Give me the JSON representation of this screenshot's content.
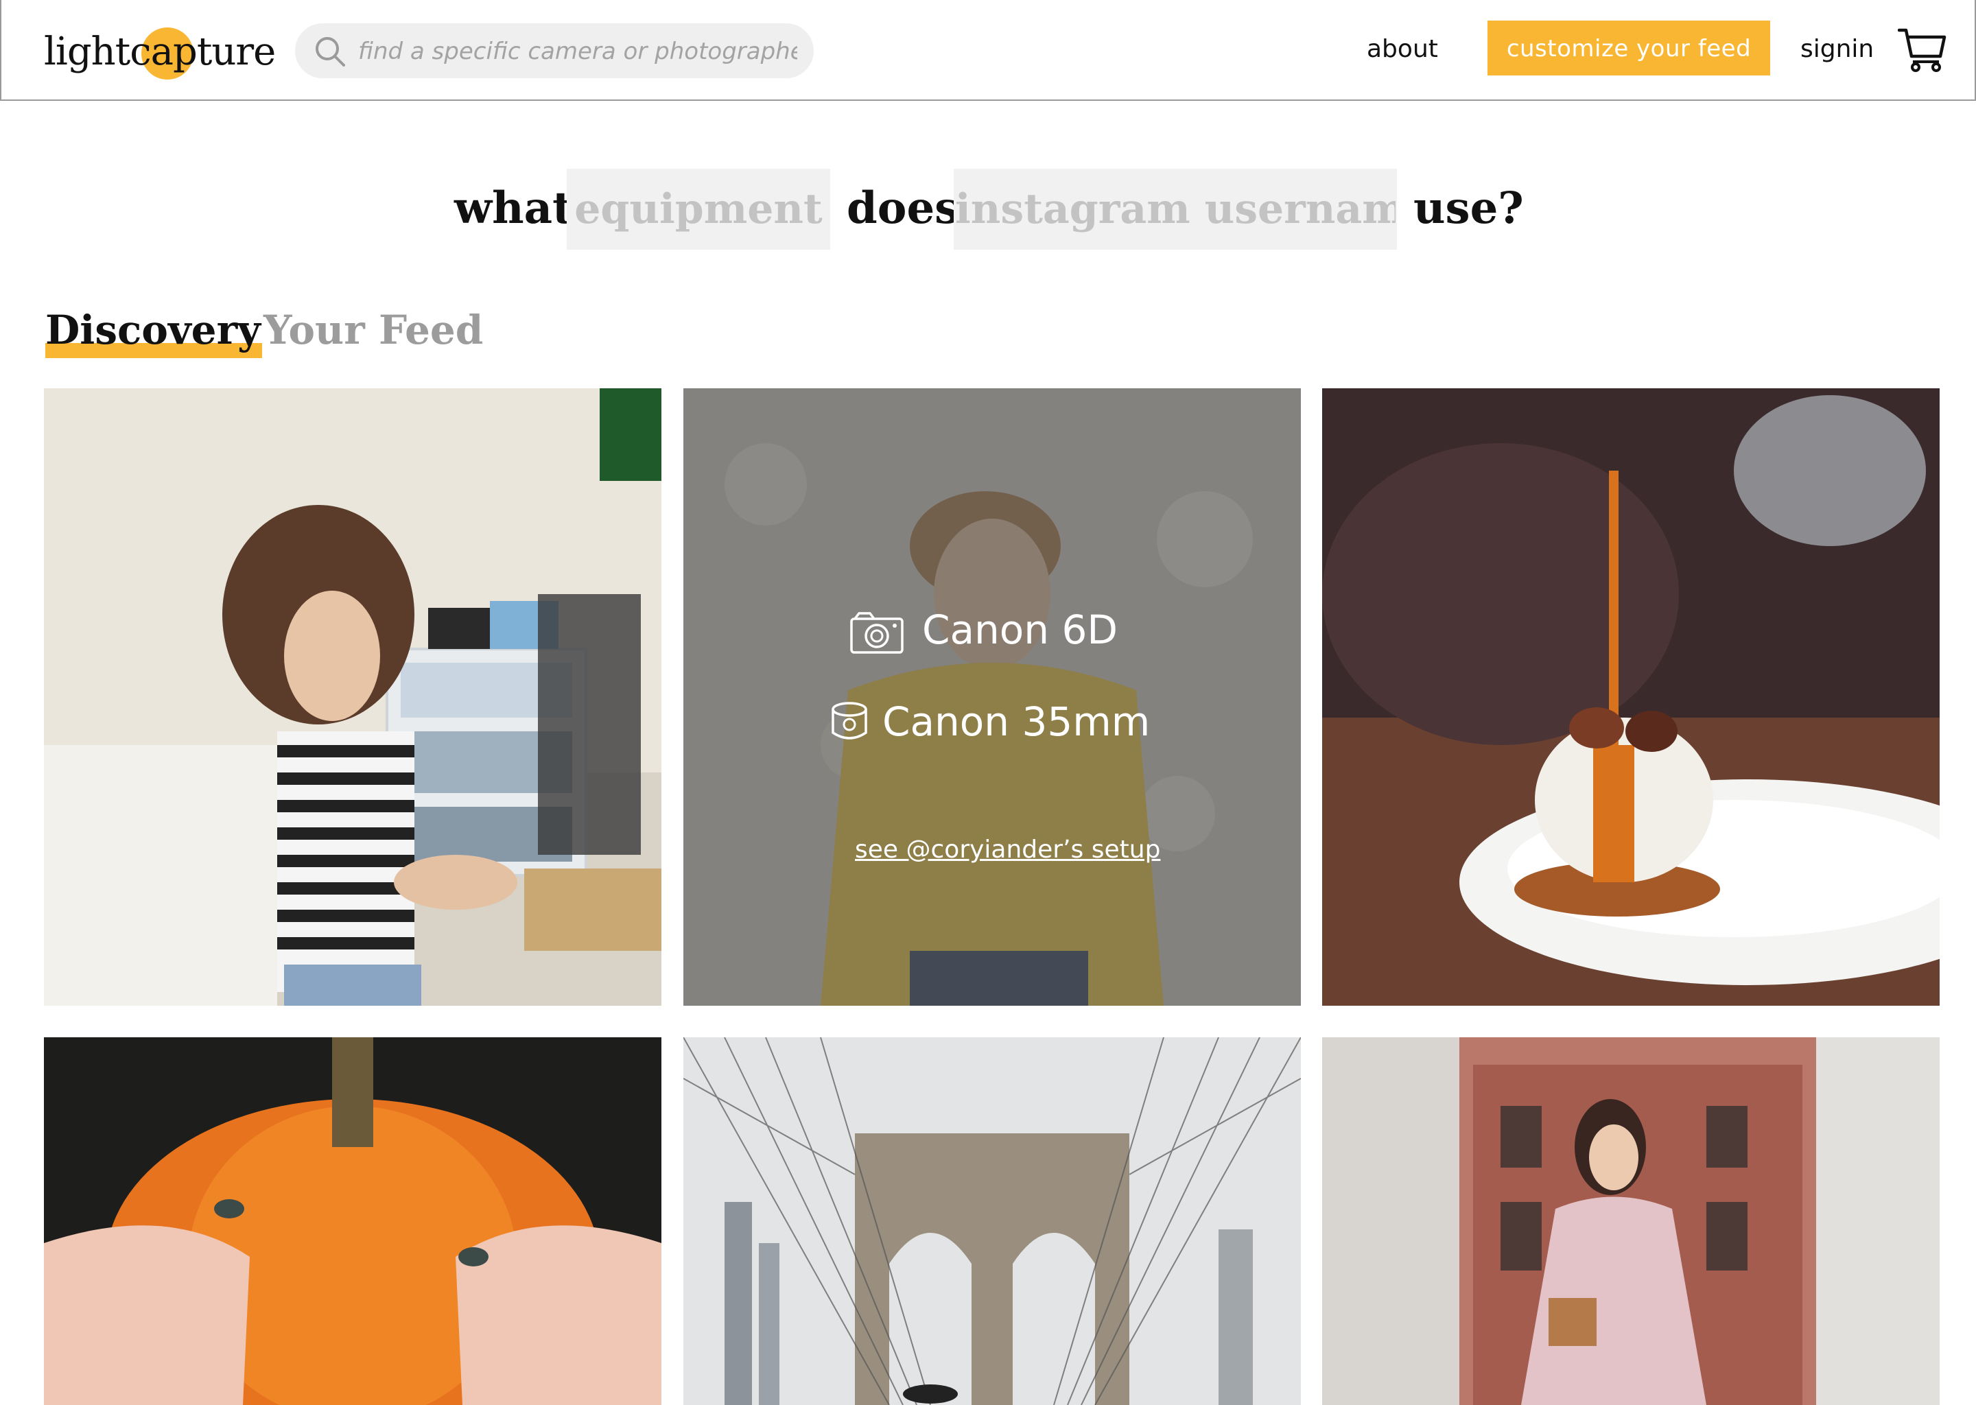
{
  "brand": {
    "logo_text": "lightcapture",
    "accent_color": "#f9b633"
  },
  "header": {
    "search_placeholder": "find a specific camera or photographer",
    "search_icon": "search-icon",
    "about_label": "about",
    "cta_label": "customize your feed",
    "signin_label": "signin",
    "cart_icon": "cart-icon"
  },
  "question": {
    "word_what": "what",
    "equipment_placeholder": "equipment",
    "word_does": "does",
    "username_placeholder": "instagram username",
    "word_use": "use?"
  },
  "tabs": {
    "discovery": "Discovery",
    "your_feed": "Your Feed"
  },
  "grid": {
    "photos": [
      {
        "subject": "woman in striped shirt sitting in a room"
      },
      {
        "subject": "man with glasses in yellow shirt",
        "overlay": {
          "camera_icon": "camera-icon",
          "camera": "Canon 6D",
          "lens_icon": "lens-icon",
          "lens": "Canon 35mm",
          "link": "see @coryiander’s setup"
        }
      },
      {
        "subject": "caramel poured over ice cream on a plate"
      },
      {
        "subject": "hands holding an orange pumpkin"
      },
      {
        "subject": "Brooklyn Bridge cables and tower"
      },
      {
        "subject": "woman in patterned dress with bag on street"
      }
    ]
  }
}
